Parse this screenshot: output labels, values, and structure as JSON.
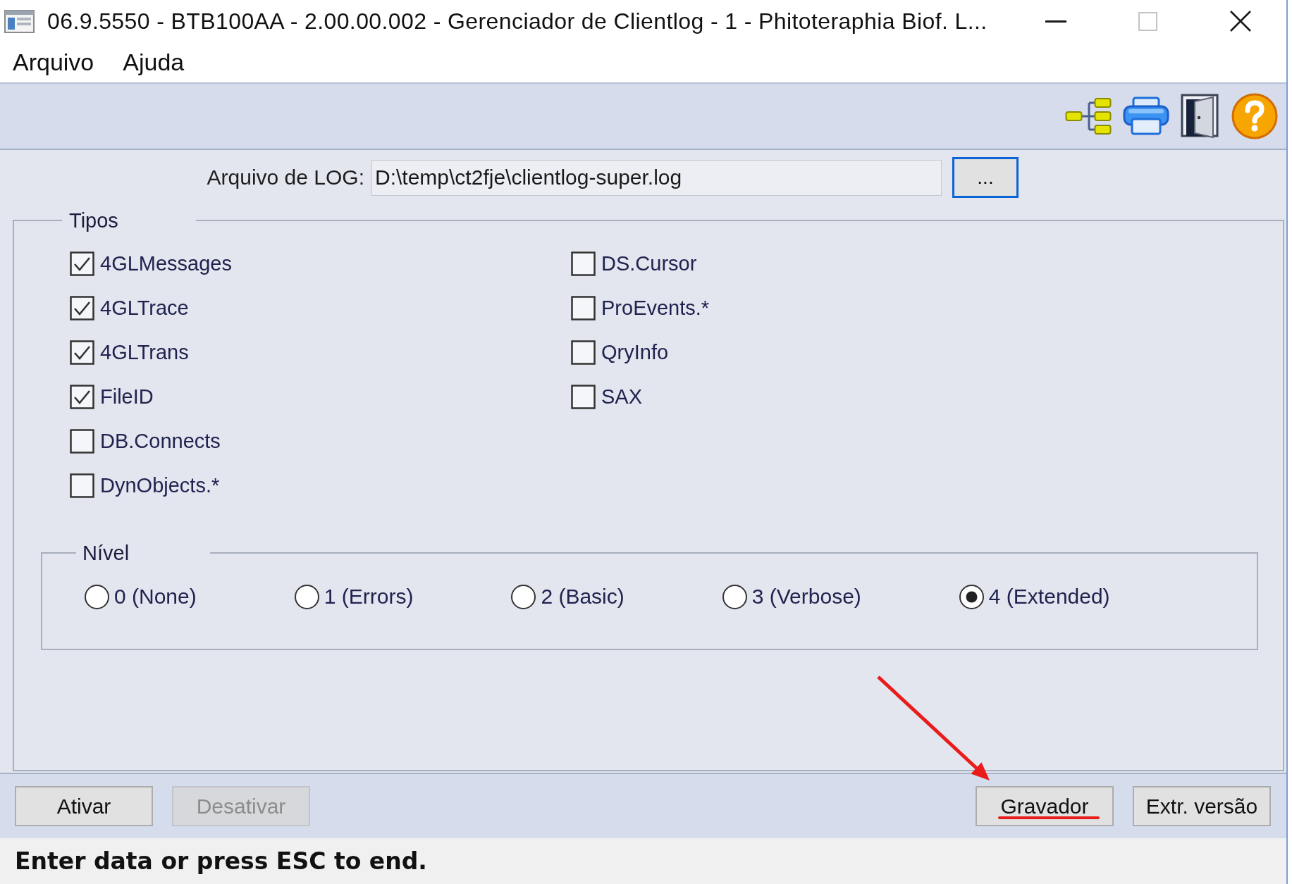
{
  "window": {
    "title": "06.9.5550 - BTB100AA - 2.00.00.002 - Gerenciador de Clientlog - 1 - Phitoteraphia Biof. L...",
    "controls": [
      {
        "kind": "minimize",
        "disabled": false
      },
      {
        "kind": "maximize",
        "disabled": true
      },
      {
        "kind": "close",
        "disabled": false
      }
    ]
  },
  "menu": [
    {
      "label": "Arquivo"
    },
    {
      "label": "Ajuda"
    }
  ],
  "log_file": {
    "label": "Arquivo de LOG:",
    "value": "D:\\temp\\ct2fje\\clientlog-super.log",
    "browse_button": {
      "label": "...",
      "focused": true
    }
  },
  "types": {
    "title": "Tipos",
    "columns": [
      {
        "items": [
          {
            "label": "4GLMessages",
            "checked": true
          },
          {
            "label": "4GLTrace",
            "checked": true
          },
          {
            "label": "4GLTrans",
            "checked": true
          },
          {
            "label": "FileID",
            "checked": true
          },
          {
            "label": "DB.Connects",
            "checked": false
          },
          {
            "label": "DynObjects.*",
            "checked": false
          }
        ]
      },
      {
        "items": [
          {
            "label": "DS.Cursor",
            "checked": false
          },
          {
            "label": "ProEvents.*",
            "checked": false
          },
          {
            "label": "QryInfo",
            "checked": false
          },
          {
            "label": "SAX",
            "checked": false
          }
        ]
      }
    ],
    "level": {
      "title": "Nível",
      "options": [
        {
          "label": "0 (None)",
          "selected": false
        },
        {
          "label": "1 (Errors)",
          "selected": false
        },
        {
          "label": "2 (Basic)",
          "selected": false
        },
        {
          "label": "3 (Verbose)",
          "selected": false
        },
        {
          "label": "4 (Extended)",
          "selected": true
        }
      ]
    }
  },
  "bottom_bar": {
    "left_buttons": [
      {
        "label": "Ativar",
        "disabled": false,
        "highlighted": false
      },
      {
        "label": "Desativar",
        "disabled": true,
        "highlighted": false
      }
    ],
    "right_buttons": [
      {
        "label": "Gravador",
        "disabled": false,
        "highlighted": true
      },
      {
        "label": "Extr. versão",
        "disabled": false,
        "highlighted": false
      }
    ]
  },
  "status_bar": {
    "text": "Enter data or press ESC to end."
  }
}
